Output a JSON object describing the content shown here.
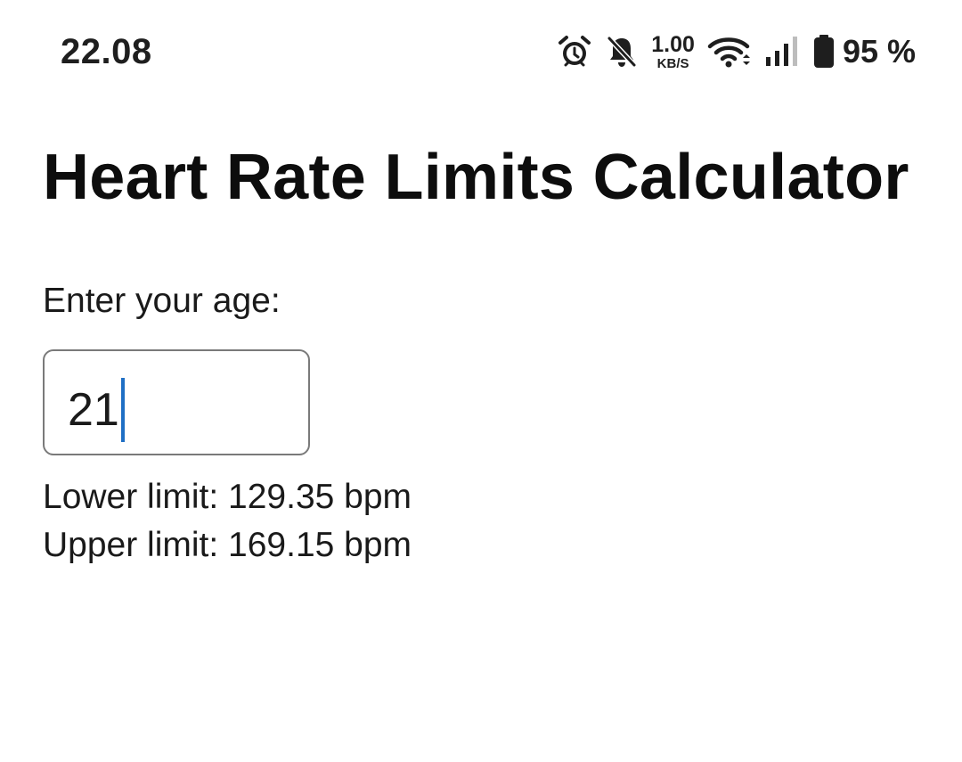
{
  "status_bar": {
    "time": "22.08",
    "icons": [
      "alarm-icon",
      "bell-muted-icon",
      "network-speed",
      "wifi-icon",
      "cell-signal-icon",
      "battery-icon"
    ],
    "net_speed_value": "1.00",
    "net_speed_unit": "KB/S",
    "battery_percent": "95 %"
  },
  "app": {
    "title": "Heart Rate Limits Calculator",
    "age_label": "Enter your age:",
    "age_value": "21",
    "lower_limit_text": "Lower limit: 129.35 bpm",
    "upper_limit_text": "Upper limit: 169.15 bpm"
  },
  "colors": {
    "background": "#ffffff",
    "text": "#111111",
    "input_border": "#7a7a7a",
    "caret": "#1f6fc5"
  }
}
